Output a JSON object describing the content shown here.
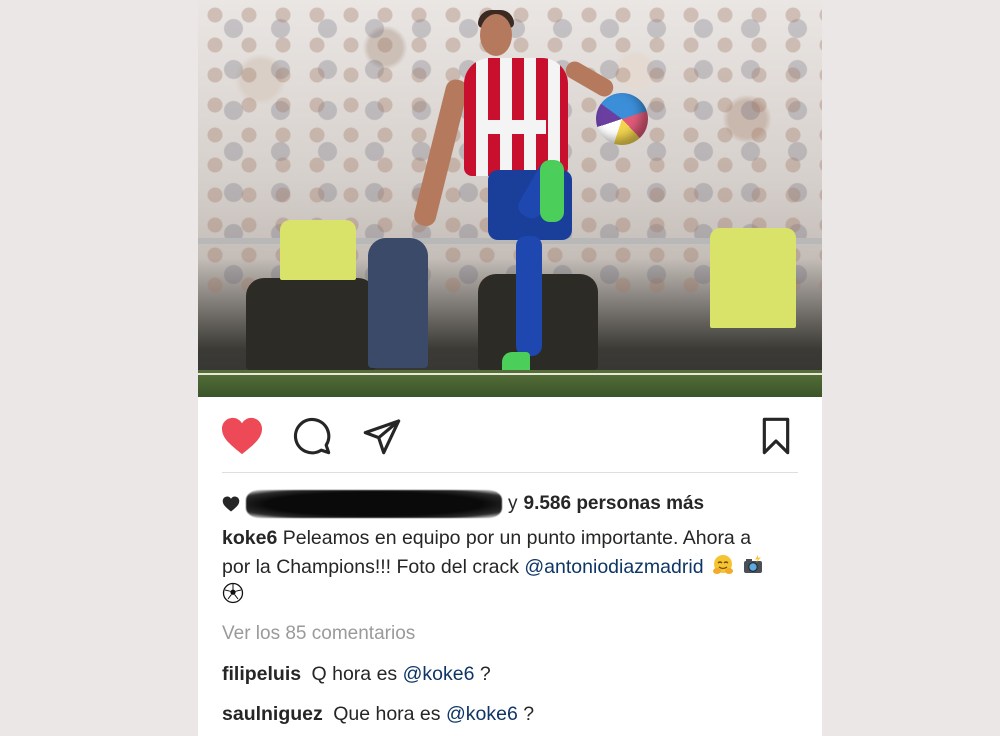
{
  "post": {
    "photo_alt": "",
    "actions": {
      "like": "heart-icon",
      "comment": "comment-icon",
      "share": "share-icon",
      "save": "bookmark-icon",
      "liked": true,
      "like_color": "#ed4956"
    },
    "likes": {
      "prefix_hidden": true,
      "connector": "y",
      "count_text": "9.586 personas más"
    },
    "caption": {
      "username": "koke6",
      "text_before_mention": "Peleamos en equipo por un punto importante. Ahora a por la Champions!!! Foto del crack",
      "mention": "@antoniodiazmadrid",
      "emojis": [
        "hugging-face-emoji",
        "camera-flash-emoji",
        "soccer-ball-emoji"
      ]
    },
    "view_comments": "Ver los 85 comentarios",
    "comments": [
      {
        "username": "filipeluis",
        "text": "Q hora es",
        "mention": "@koke6",
        "suffix": "?"
      },
      {
        "username": "saulniguez",
        "text": "Que hora es",
        "mention": "@koke6",
        "suffix": "?"
      }
    ]
  },
  "colors": {
    "background": "#ebe7e6",
    "card": "#ffffff",
    "mention": "#0f3566",
    "muted": "#9a9a9a"
  }
}
